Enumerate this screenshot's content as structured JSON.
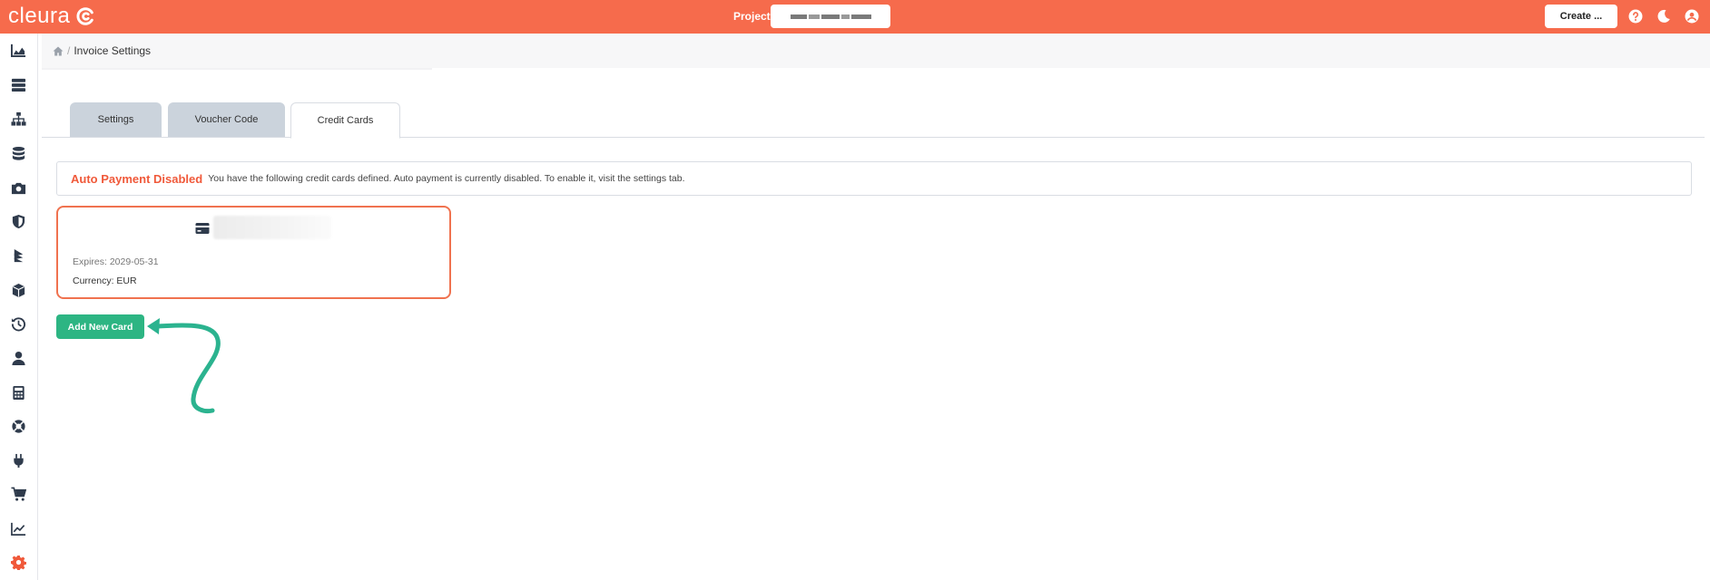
{
  "brand": {
    "name": "cleura"
  },
  "header": {
    "project_label": "Project",
    "create_label": "Create ...",
    "icons": [
      "help-icon",
      "moon-icon",
      "user-circle-icon"
    ]
  },
  "sidebar": {
    "items": [
      {
        "name": "dashboard",
        "icon": "area-chart-icon"
      },
      {
        "name": "servers",
        "icon": "server-icon"
      },
      {
        "name": "network",
        "icon": "sitemap-icon"
      },
      {
        "name": "storage",
        "icon": "database-icon"
      },
      {
        "name": "snapshots",
        "icon": "camera-icon"
      },
      {
        "name": "security",
        "icon": "shield-icon"
      },
      {
        "name": "layers",
        "icon": "layers-icon"
      },
      {
        "name": "images",
        "icon": "cube-icon"
      },
      {
        "name": "history",
        "icon": "history-icon"
      },
      {
        "name": "users",
        "icon": "user-icon"
      },
      {
        "name": "billing",
        "icon": "calculator-icon"
      },
      {
        "name": "support",
        "icon": "lifebuoy-icon"
      },
      {
        "name": "integrations",
        "icon": "plug-icon"
      },
      {
        "name": "marketplace",
        "icon": "cart-icon"
      },
      {
        "name": "metrics",
        "icon": "line-chart-icon"
      },
      {
        "name": "settings",
        "icon": "gear-icon",
        "active": true
      }
    ]
  },
  "breadcrumb": {
    "current": "Invoice Settings",
    "separator": "/"
  },
  "tabs": [
    {
      "label": "Settings",
      "active": false
    },
    {
      "label": "Voucher Code",
      "active": false
    },
    {
      "label": "Credit Cards",
      "active": true
    }
  ],
  "alert": {
    "title": "Auto Payment Disabled",
    "message": "You have the following credit cards defined. Auto payment is currently disabled. To enable it, visit the settings tab."
  },
  "card": {
    "expires": "Expires: 2029-05-31",
    "currency": "Currency: EUR"
  },
  "actions": {
    "add_card_label": "Add New Card"
  },
  "colors": {
    "accent": "#f66b4c",
    "alert_title": "#f0593a",
    "card_border": "#f0724f",
    "success_button": "#2db583",
    "annotation_arrow": "#2bb38f",
    "tab_inactive": "#cbd3dc"
  }
}
